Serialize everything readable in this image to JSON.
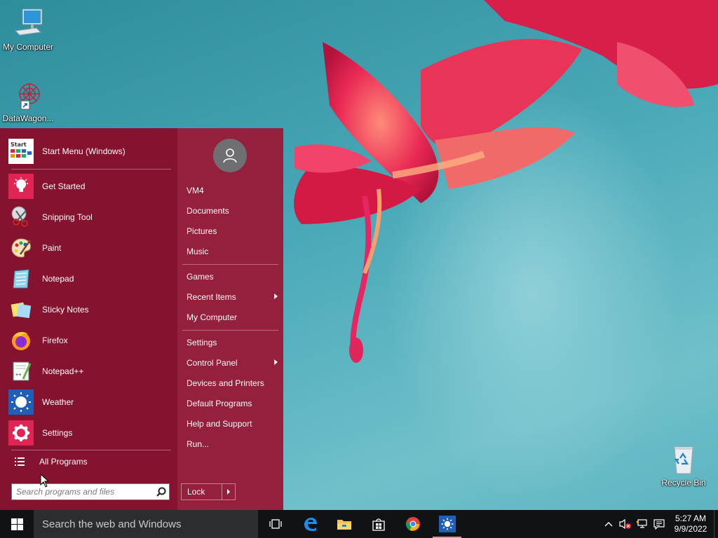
{
  "desktop": {
    "icons": [
      {
        "label": "My Computer",
        "icon": "computer-icon"
      },
      {
        "label": "DataWagon...",
        "icon": "datawagon-shortcut-icon"
      },
      {
        "label": "Recycle Bin",
        "icon": "recycle-bin-icon"
      }
    ]
  },
  "start_menu": {
    "pinned_header": {
      "label": "Start Menu (Windows)",
      "icon_text": "Start"
    },
    "programs": [
      {
        "label": "Get Started",
        "icon": "lightbulb-icon"
      },
      {
        "label": "Snipping Tool",
        "icon": "scissors-icon"
      },
      {
        "label": "Paint",
        "icon": "palette-icon"
      },
      {
        "label": "Notepad",
        "icon": "notepad-icon"
      },
      {
        "label": "Sticky Notes",
        "icon": "sticky-notes-icon"
      },
      {
        "label": "Firefox",
        "icon": "firefox-icon"
      },
      {
        "label": "Notepad++",
        "icon": "notepadpp-icon"
      },
      {
        "label": "Weather",
        "icon": "weather-sun-icon"
      },
      {
        "label": "Settings",
        "icon": "gear-icon"
      }
    ],
    "all_programs_label": "All Programs",
    "search": {
      "placeholder": "Search programs and files",
      "value": ""
    },
    "right": {
      "user": "user-avatar-icon",
      "items": [
        {
          "label": "VM4"
        },
        {
          "label": "Documents"
        },
        {
          "label": "Pictures"
        },
        {
          "label": "Music"
        },
        {
          "label": "Games"
        },
        {
          "label": "Recent Items",
          "submenu": true
        },
        {
          "label": "My Computer"
        },
        {
          "label": "Settings"
        },
        {
          "label": "Control Panel",
          "submenu": true
        },
        {
          "label": "Devices and Printers"
        },
        {
          "label": "Default Programs"
        },
        {
          "label": "Help and Support"
        },
        {
          "label": "Run..."
        }
      ],
      "lock_label": "Lock"
    },
    "colors": {
      "menu_bg": "#85132f",
      "right_bg": "#95203b"
    }
  },
  "taskbar": {
    "search_text": "Search the web and Windows",
    "apps": [
      "task-view-icon",
      "edge-icon",
      "file-explorer-icon",
      "store-icon",
      "chrome-icon",
      "weather-app-icon"
    ],
    "clock": {
      "time": "5:27 AM",
      "date": "9/9/2022"
    },
    "tray": [
      "show-hidden-icons-chevron",
      "volume-muted-icon",
      "network-icon",
      "notification-icon"
    ]
  }
}
